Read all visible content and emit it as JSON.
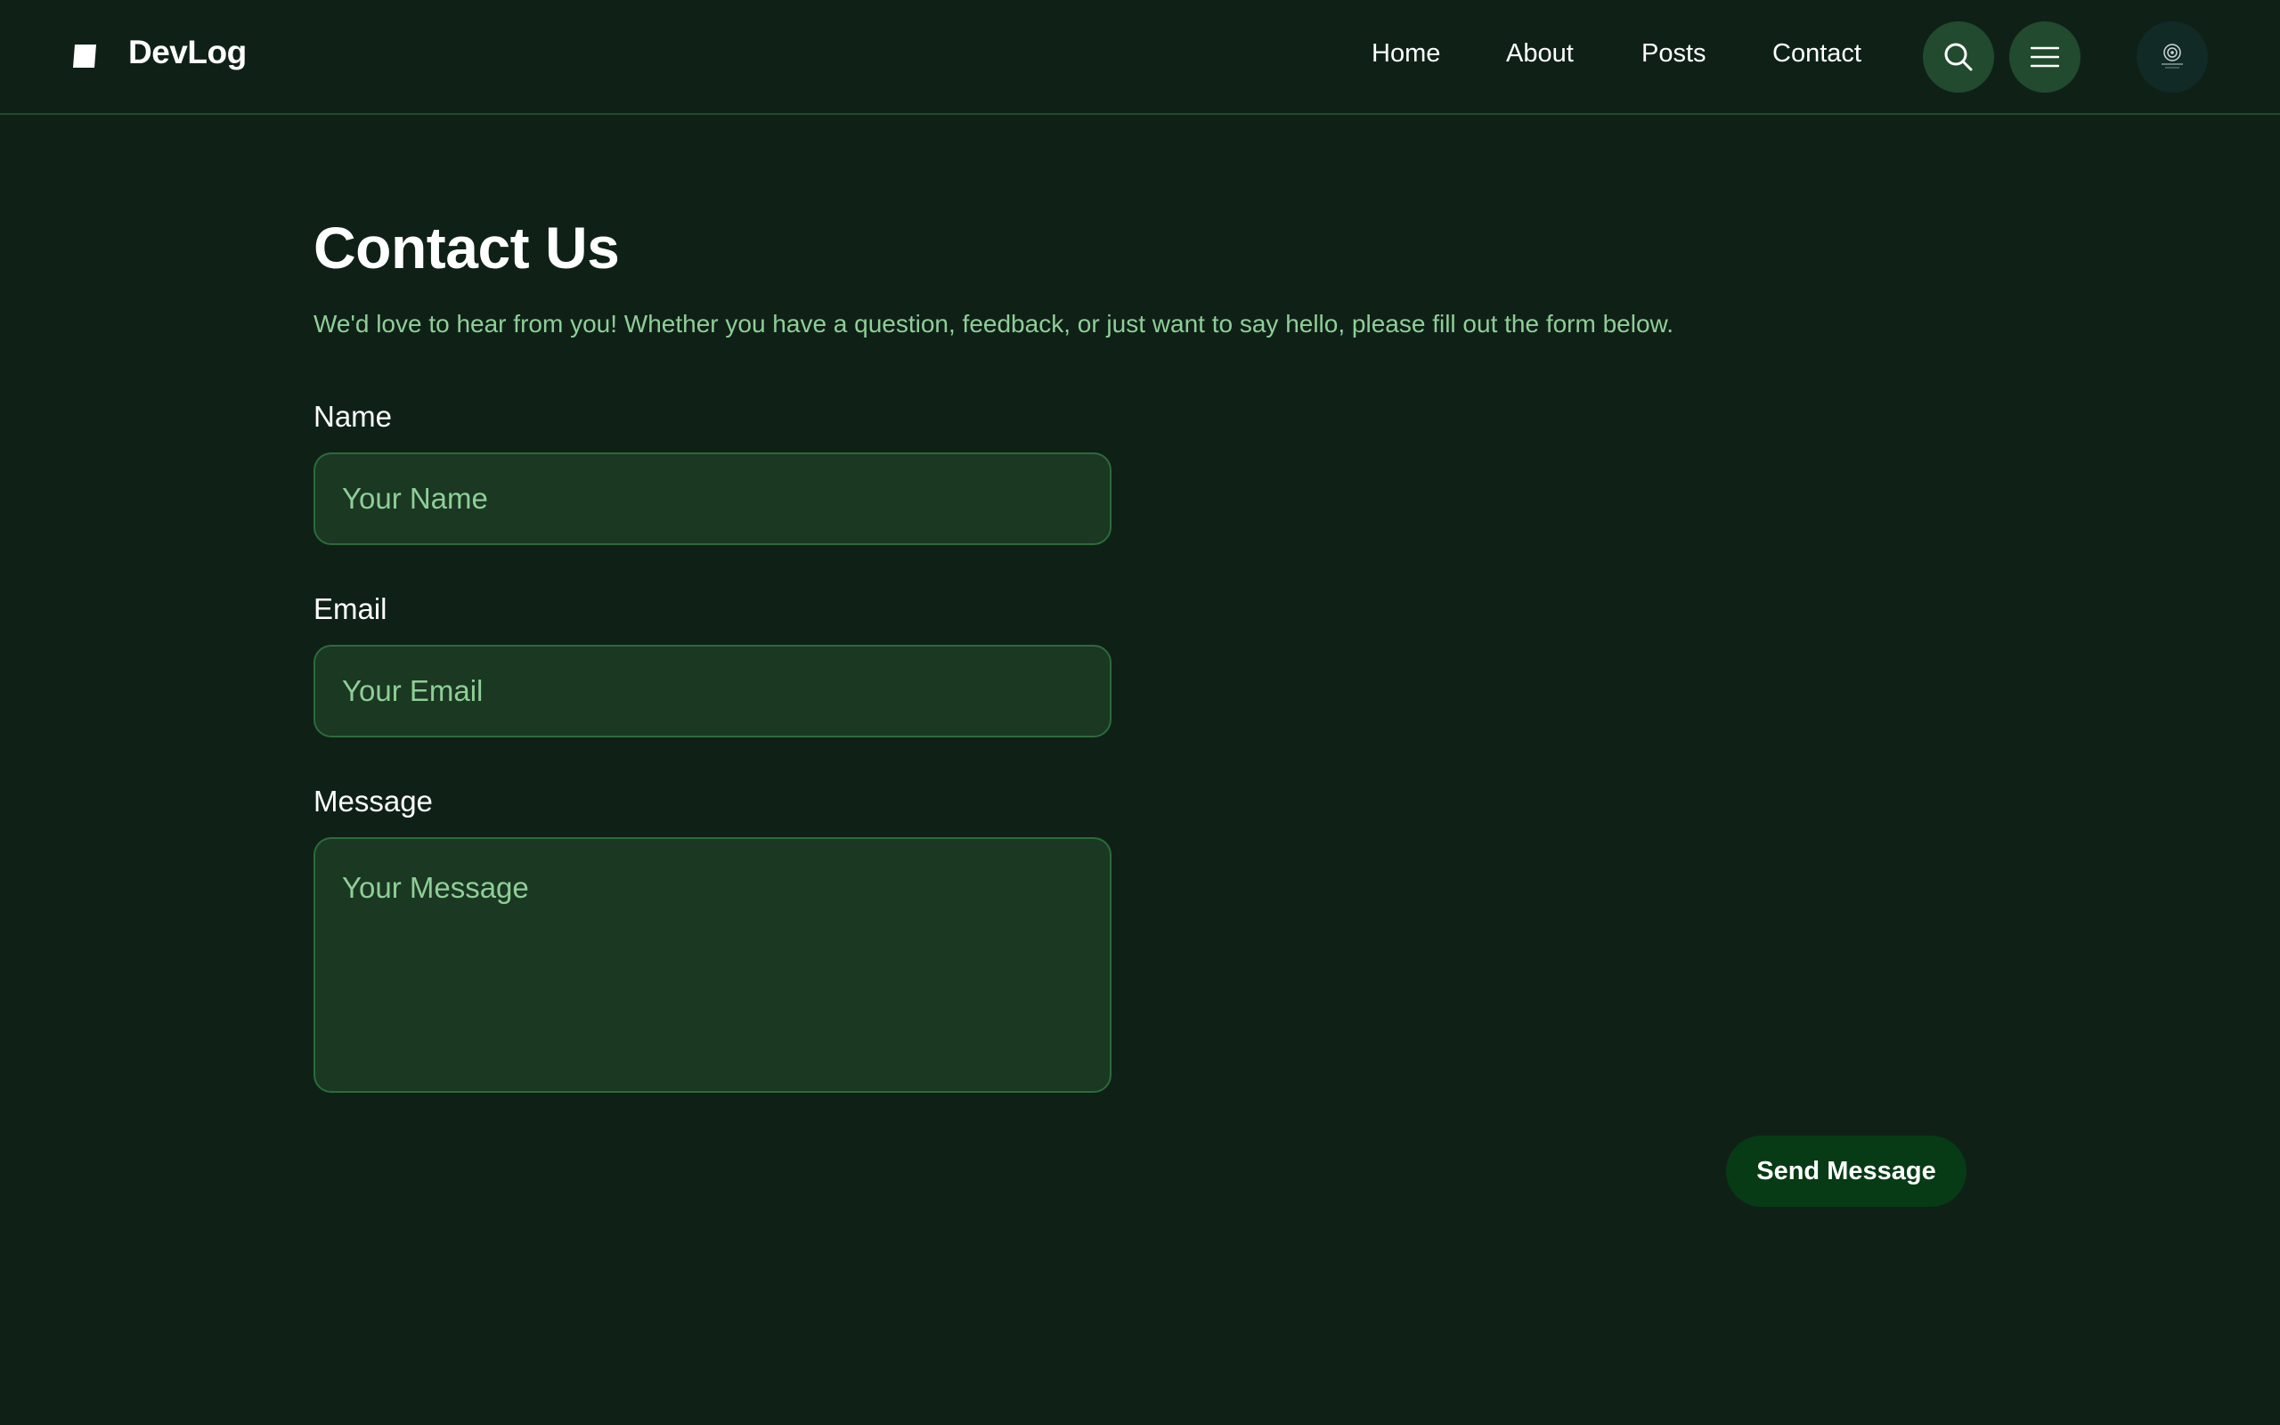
{
  "header": {
    "brand": "DevLog",
    "logo_icon": "brand-logo-icon",
    "nav": [
      "Home",
      "About",
      "Posts",
      "Contact"
    ],
    "search_icon": "search-icon",
    "menu_icon": "hamburger-menu-icon",
    "avatar_icon": "user-avatar"
  },
  "main": {
    "title": "Contact Us",
    "subtitle": "We'd love to hear from you! Whether you have a question, feedback, or just want to say hello, please fill out the form below."
  },
  "form": {
    "name_label": "Name",
    "name_placeholder": "Your Name",
    "email_label": "Email",
    "email_placeholder": "Your Email",
    "message_label": "Message",
    "message_placeholder": "Your Message",
    "submit_label": "Send Message"
  },
  "colors": {
    "background": "#0f2117",
    "input_bg": "#1a3822",
    "input_border": "#2c6b3a",
    "accent_text": "#8fce97",
    "button_bg": "#063b15"
  }
}
